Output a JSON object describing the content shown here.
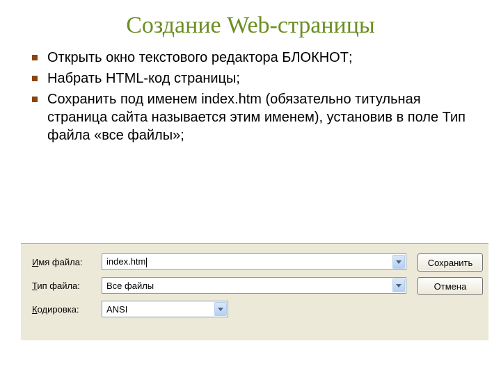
{
  "title": "Создание Web-страницы",
  "bullets": [
    "Открыть окно текстового редактора БЛОКНОТ;",
    "Набрать HTML-код страницы;",
    "Сохранить под именем index.htm (обязательно титульная страница сайта называется этим именем), установив в поле Тип файла «все файлы»;"
  ],
  "dialog": {
    "filename_label_pre": "",
    "filename_label_ul": "И",
    "filename_label_post": "мя файла:",
    "filetype_label_pre": "",
    "filetype_label_ul": "Т",
    "filetype_label_post": "ип файла:",
    "encoding_label_pre": "",
    "encoding_label_ul": "К",
    "encoding_label_post": "одировка:",
    "filename_value": "index.htm",
    "filetype_value": "Все файлы",
    "encoding_value": "ANSI",
    "save_label": "Сохранить",
    "cancel_label": "Отмена"
  }
}
